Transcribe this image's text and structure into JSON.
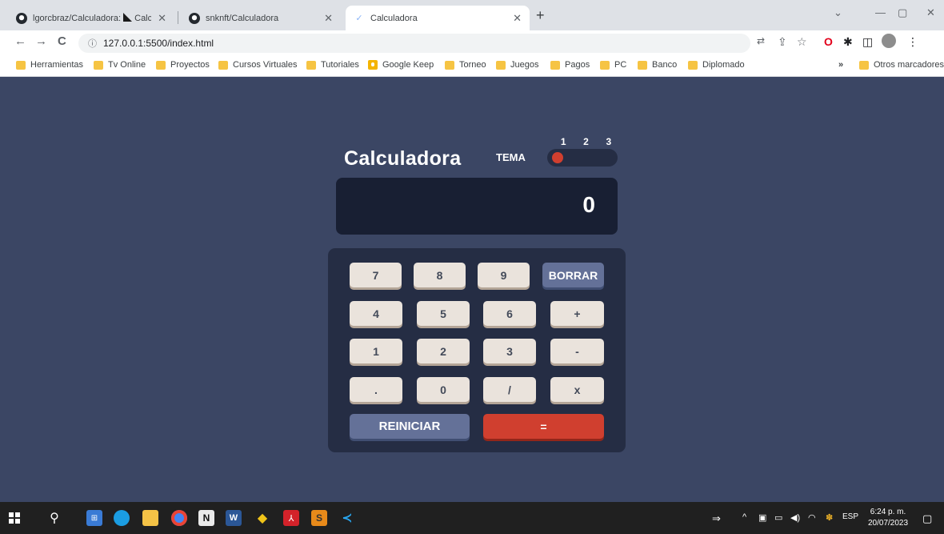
{
  "browser": {
    "tabs": [
      {
        "label": "lgorcbraz/Calculadora: ",
        "label2": "Calcul"
      },
      {
        "label": "snknft/Calculadora"
      },
      {
        "label": "Calculadora"
      }
    ],
    "address": "127.0.0.1:5500/index.html",
    "bookmarks": [
      "Herramientas",
      "Tv Online",
      "Proyectos",
      "Cursos Virtuales",
      "Tutoriales",
      "Google Keep",
      "Torneo",
      "Juegos",
      "Pagos",
      "PC",
      "Banco",
      "Diplomado"
    ],
    "overflow": "»",
    "other_bookmarks": "Otros marcadores"
  },
  "app": {
    "title": "Calculadora",
    "theme_label": "TEMA",
    "theme_options": [
      "1",
      "2",
      "3"
    ],
    "theme_selected": 1,
    "display_value": "0",
    "keys": {
      "k7": "7",
      "k8": "8",
      "k9": "9",
      "del": "BORRAR",
      "k4": "4",
      "k5": "5",
      "k6": "6",
      "plus": "+",
      "k1": "1",
      "k2": "2",
      "k3": "3",
      "minus": "-",
      "dot": ".",
      "k0": "0",
      "div": "/",
      "mul": "x",
      "reset": "REINICIAR",
      "equals": "="
    }
  },
  "colors": {
    "background": "#3b4664",
    "screen": "#181f33",
    "keypad": "#252d44",
    "key": "#eae3dc",
    "key_blue": "#647198",
    "key_red": "#d03f2f"
  },
  "taskbar": {
    "lang": "ESP",
    "time": "6:24 p. m.",
    "date": "20/07/2023"
  }
}
